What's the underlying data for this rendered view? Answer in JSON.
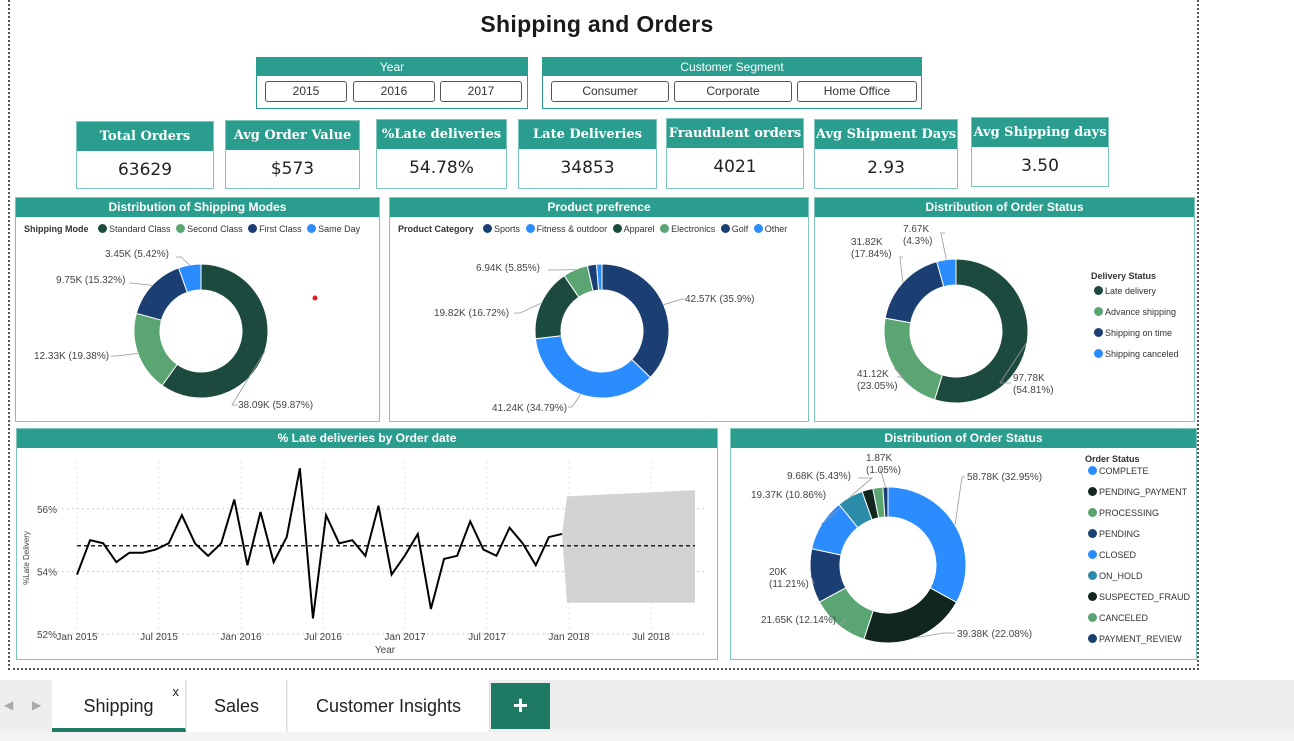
{
  "title": "Shipping and Orders",
  "slicers": {
    "year": {
      "label": "Year",
      "options": [
        "2015",
        "2016",
        "2017"
      ]
    },
    "segment": {
      "label": "Customer Segment",
      "options": [
        "Consumer",
        "Corporate",
        "Home Office"
      ]
    }
  },
  "kpis": [
    {
      "label": "Total Orders",
      "value": "63629"
    },
    {
      "label": "Avg Order Value",
      "value": "$573"
    },
    {
      "label": "%Late deliveries",
      "value": "54.78%"
    },
    {
      "label": "Late Deliveries",
      "value": "34853"
    },
    {
      "label": "Fraudulent orders",
      "value": "4021"
    },
    {
      "label": "Avg Shipment Days",
      "value": "2.93"
    },
    {
      "label": "Avg Shipping days",
      "value": "3.50"
    }
  ],
  "colors": {
    "teal": "#2a9d8f",
    "dark": "#1d4a3f",
    "green": "#5aa572",
    "navy": "#1b3f73",
    "blue": "#2b8cff",
    "black": "#111111"
  },
  "chart_data": [
    {
      "type": "pie",
      "title": "Distribution of Shipping Modes",
      "legend_title": "Shipping Mode",
      "categories": [
        "Standard Class",
        "Second Class",
        "First Class",
        "Same Day"
      ],
      "values": [
        38.09,
        12.33,
        9.75,
        3.45
      ],
      "value_labels": [
        "38.09K (59.87%)",
        "12.33K (19.38%)",
        "9.75K (15.32%)",
        "3.45K (5.42%)"
      ],
      "colors": [
        "#1d4a3f",
        "#5aa572",
        "#1b3f73",
        "#2b8cff"
      ],
      "legend": "top"
    },
    {
      "type": "pie",
      "title": "Product prefrence",
      "legend_title": "Product Category",
      "categories": [
        "Sports",
        "Fitness & outdoor",
        "Apparel",
        "Electronics",
        "Golf",
        "Other"
      ],
      "values": [
        42.57,
        41.24,
        19.82,
        6.94,
        2.5,
        1.5
      ],
      "value_labels": [
        "42.57K (35.9%)",
        "41.24K (34.79%)",
        "19.82K (16.72%)",
        "6.94K (5.85%)",
        "",
        ""
      ],
      "colors": [
        "#1b3f73",
        "#2b8cff",
        "#1d4a3f",
        "#5aa572",
        "#1b3f73",
        "#2b8cff"
      ],
      "legend": "top"
    },
    {
      "type": "pie",
      "title": "Distribution of Order Status",
      "legend_title": "Delivery Status",
      "categories": [
        "Late delivery",
        "Advance shipping",
        "Shipping on time",
        "Shipping canceled"
      ],
      "values": [
        97.78,
        41.12,
        31.82,
        7.67
      ],
      "value_labels": [
        "97.78K (54.81%)",
        "41.12K (23.05%)",
        "31.82K (17.84%)",
        "7.67K (4.3%)"
      ],
      "colors": [
        "#1d4a3f",
        "#5aa572",
        "#1b3f73",
        "#2b8cff"
      ],
      "legend": "right"
    },
    {
      "type": "line",
      "title": "% Late deliveries by Order date",
      "xlabel": "Year",
      "ylabel": "%Late Delivery",
      "x_ticks": [
        "Jan 2015",
        "Jul 2015",
        "Jan 2016",
        "Jul 2016",
        "Jan 2017",
        "Jul 2017",
        "Jan 2018",
        "Jul 2018"
      ],
      "y_ticks": [
        "52%",
        "54%",
        "56%"
      ],
      "ylim": [
        52,
        57.5
      ],
      "series": [
        {
          "values": [
            53.9,
            55.0,
            54.9,
            54.3,
            54.6,
            54.6,
            54.7,
            54.9,
            55.8,
            54.9,
            54.5,
            54.9,
            56.3,
            54.2,
            55.9,
            54.3,
            55.1,
            57.3,
            52.5,
            55.8,
            54.9,
            55.0,
            54.5,
            56.1,
            53.9,
            54.5,
            55.2,
            52.8,
            54.4,
            54.5,
            55.6,
            54.7,
            54.5,
            55.4,
            54.9,
            54.2,
            55.1,
            55.2
          ]
        }
      ],
      "trend": 54.82,
      "forecast_band": [
        53.0,
        56.6
      ]
    },
    {
      "type": "pie",
      "title": "Distribution of Order Status",
      "legend_title": "Order Status",
      "categories": [
        "COMPLETE",
        "PENDING_PAYMENT",
        "PROCESSING",
        "PENDING",
        "CLOSED",
        "ON_HOLD",
        "SUSPECTED_FRAUD",
        "CANCELED",
        "PAYMENT_REVIEW"
      ],
      "values": [
        58.78,
        39.38,
        21.65,
        20.0,
        19.37,
        9.68,
        4.06,
        3.69,
        1.87
      ],
      "value_labels": [
        "58.78K (32.95%)",
        "39.38K (22.08%)",
        "21.65K (12.14%)",
        "20K (11.21%)",
        "19.37K (10.86%)",
        "9.68K (5.43%)",
        "",
        "",
        "1.87K (1.05%)"
      ],
      "colors": [
        "#2b8cff",
        "#10261f",
        "#5aa572",
        "#1b3f73",
        "#2b8cff",
        "#2a8ca8",
        "#10261f",
        "#5aa572",
        "#1b3f73"
      ],
      "legend": "right"
    }
  ],
  "tabs": {
    "shipping": "Shipping",
    "sales": "Sales",
    "insights": "Customer Insights",
    "close": "x",
    "add": "+"
  }
}
